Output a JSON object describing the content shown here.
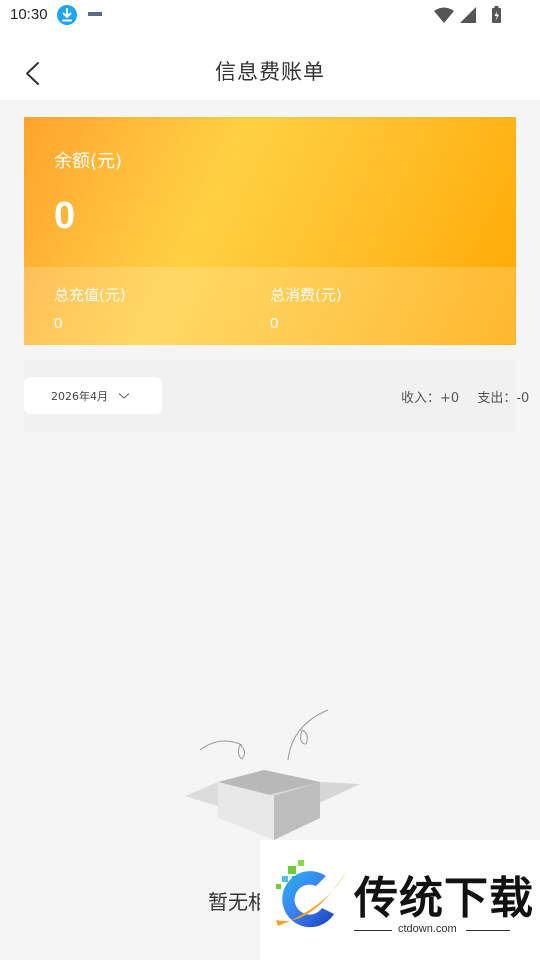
{
  "status_bar": {
    "time": "10:30"
  },
  "header": {
    "title": "信息费账单"
  },
  "balance": {
    "label": "余额(元)",
    "value": "0",
    "total_recharge_label": "总充值(元)",
    "total_recharge_value": "0",
    "total_consume_label": "总消费(元)",
    "total_consume_value": "0"
  },
  "filter": {
    "month": "2026年4月",
    "income_label": "收入：+0",
    "expense_label": "支出：-0"
  },
  "empty": {
    "text": "暂无相"
  },
  "watermark": {
    "title": "传统下载",
    "url": "ctdown.com"
  },
  "colors": {
    "card_start": "#ffa32e",
    "card_mid": "#ffd042",
    "card_end": "#ffa800",
    "download_icon": "#1aa6f0"
  }
}
